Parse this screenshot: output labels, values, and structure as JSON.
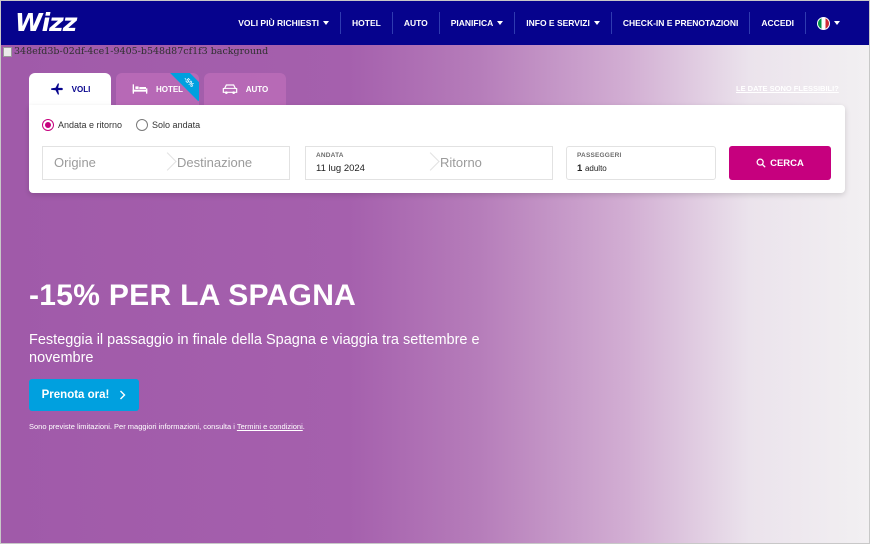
{
  "nav": {
    "logo": "Wizz",
    "items": [
      {
        "label": "VOLI PIÙ RICHIESTI",
        "dropdown": true
      },
      {
        "label": "HOTEL",
        "dropdown": false
      },
      {
        "label": "AUTO",
        "dropdown": false
      },
      {
        "label": "PIANIFICA",
        "dropdown": true
      },
      {
        "label": "INFO E SERVIZI",
        "dropdown": true
      },
      {
        "label": "CHECK-IN E PRENOTAZIONI",
        "dropdown": false
      },
      {
        "label": "ACCEDI",
        "dropdown": false
      }
    ],
    "language_flag": "italy-flag",
    "color": "#06038d"
  },
  "broken_image_alt": "348efd3b-02df-4ce1-9405-b548d87cf1f3 background",
  "tabs": [
    {
      "label": "VOLI",
      "icon": "plane-icon",
      "active": true
    },
    {
      "label": "HOTEL",
      "icon": "bed-icon",
      "active": false,
      "badge": "-5%"
    },
    {
      "label": "AUTO",
      "icon": "car-icon",
      "active": false
    }
  ],
  "flexible_dates_link": "LE DATE SONO FLESSIBILI?",
  "search": {
    "trip_types": [
      {
        "label": "Andata e ritorno",
        "selected": true
      },
      {
        "label": "Solo andata",
        "selected": false
      }
    ],
    "origin_placeholder": "Origine",
    "destination_placeholder": "Destinazione",
    "departure_label": "ANDATA",
    "departure_value": "11 lug 2024",
    "return_placeholder": "Ritorno",
    "passengers_label": "PASSEGGERI",
    "passengers_count": "1",
    "passengers_unit": "adulto",
    "search_button": "CERCA",
    "accent": "#c6007e"
  },
  "hero": {
    "title": "-15% PER LA SPAGNA",
    "subtitle": "Festeggia il passaggio in finale della Spagna e viaggia tra settembre e novembre",
    "cta": "Prenota ora!",
    "cta_color": "#00a0df",
    "disclaimer_text": "Sono previste limitazioni. Per maggiori informazioni, consulta i ",
    "disclaimer_link": "Termini e condizioni",
    "disclaimer_end": "."
  }
}
